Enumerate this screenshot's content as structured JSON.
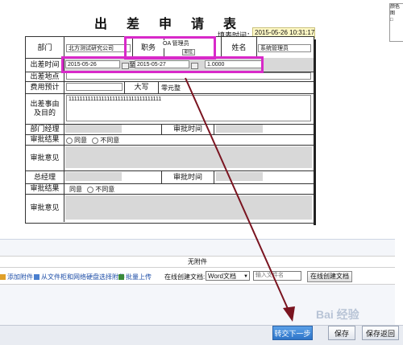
{
  "form": {
    "title": "出 差 申 请 表",
    "fill_time_label": "填表时间：",
    "fill_time_value": "2015-05-26 10:31:17",
    "dept_label": "部门",
    "dept_value": "北方测试研究公司",
    "position_label": "职务",
    "position_value": "OA 管理员",
    "position_btn": "职位",
    "name_label": "姓名",
    "name_value": "系统管理员",
    "trip_time_label": "出差时间",
    "start_date": "2015-05-26",
    "to_label": "至",
    "end_date": "2015-05-27",
    "days_value": "1.0000",
    "place_label": "出差地点",
    "cost_label": "费用预计",
    "capital_label": "大写",
    "capital_value": "零元整",
    "reason_label": "出差事由及目的",
    "reason_value": "1111111111111111111111111111111111",
    "dept_mgr_label": "部门经理",
    "approve_time_label": "审批时间",
    "approve_result_label": "审批结果",
    "agree_label": "同意",
    "disagree_label": "不同意",
    "approve_opinion_label": "审批意见",
    "gm_label": "总经理",
    "gm_approve_time_label": "审批时间",
    "gm_result_label": "审批结果",
    "gm_agree_label": "同意",
    "gm_disagree_label": "不同意",
    "gm_opinion_label": "审批意见"
  },
  "attachments": {
    "header": "无附件",
    "add_attachment": "添加附件",
    "from_cabinet": "从文件柜和网络硬盘选择附件",
    "batch_upload": "批量上传",
    "online_create_label": "在线创建文档:",
    "doc_type": "Word文档",
    "filename_placeholder": "输入文件名",
    "create_doc_btn": "在线创建文档"
  },
  "footer": {
    "next_btn": "转交下一步",
    "save_btn": "保存",
    "save_return_btn": "保存返回"
  },
  "side_popup": {
    "line1": "颜色",
    "line2": "图",
    "line3": "□"
  },
  "watermark": "Bai 经验",
  "colors": {
    "highlight": "#d829c9",
    "arrow": "#7a1420",
    "field_yellow": "#fff9c6",
    "primary_btn": "#2f75c8"
  }
}
